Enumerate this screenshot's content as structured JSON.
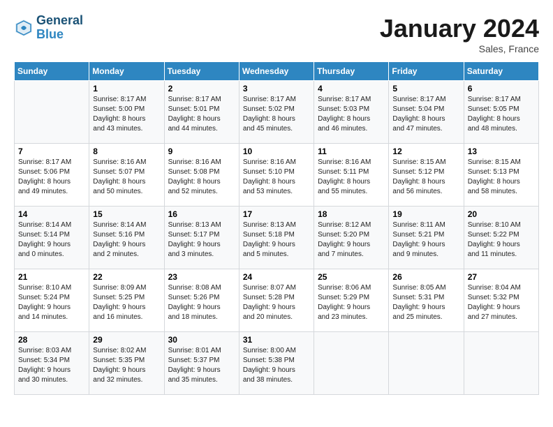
{
  "header": {
    "logo_line1": "General",
    "logo_line2": "Blue",
    "month_title": "January 2024",
    "location": "Sales, France"
  },
  "days_of_week": [
    "Sunday",
    "Monday",
    "Tuesday",
    "Wednesday",
    "Thursday",
    "Friday",
    "Saturday"
  ],
  "weeks": [
    [
      {
        "num": "",
        "info": ""
      },
      {
        "num": "1",
        "info": "Sunrise: 8:17 AM\nSunset: 5:00 PM\nDaylight: 8 hours\nand 43 minutes."
      },
      {
        "num": "2",
        "info": "Sunrise: 8:17 AM\nSunset: 5:01 PM\nDaylight: 8 hours\nand 44 minutes."
      },
      {
        "num": "3",
        "info": "Sunrise: 8:17 AM\nSunset: 5:02 PM\nDaylight: 8 hours\nand 45 minutes."
      },
      {
        "num": "4",
        "info": "Sunrise: 8:17 AM\nSunset: 5:03 PM\nDaylight: 8 hours\nand 46 minutes."
      },
      {
        "num": "5",
        "info": "Sunrise: 8:17 AM\nSunset: 5:04 PM\nDaylight: 8 hours\nand 47 minutes."
      },
      {
        "num": "6",
        "info": "Sunrise: 8:17 AM\nSunset: 5:05 PM\nDaylight: 8 hours\nand 48 minutes."
      }
    ],
    [
      {
        "num": "7",
        "info": "Sunrise: 8:17 AM\nSunset: 5:06 PM\nDaylight: 8 hours\nand 49 minutes."
      },
      {
        "num": "8",
        "info": "Sunrise: 8:16 AM\nSunset: 5:07 PM\nDaylight: 8 hours\nand 50 minutes."
      },
      {
        "num": "9",
        "info": "Sunrise: 8:16 AM\nSunset: 5:08 PM\nDaylight: 8 hours\nand 52 minutes."
      },
      {
        "num": "10",
        "info": "Sunrise: 8:16 AM\nSunset: 5:10 PM\nDaylight: 8 hours\nand 53 minutes."
      },
      {
        "num": "11",
        "info": "Sunrise: 8:16 AM\nSunset: 5:11 PM\nDaylight: 8 hours\nand 55 minutes."
      },
      {
        "num": "12",
        "info": "Sunrise: 8:15 AM\nSunset: 5:12 PM\nDaylight: 8 hours\nand 56 minutes."
      },
      {
        "num": "13",
        "info": "Sunrise: 8:15 AM\nSunset: 5:13 PM\nDaylight: 8 hours\nand 58 minutes."
      }
    ],
    [
      {
        "num": "14",
        "info": "Sunrise: 8:14 AM\nSunset: 5:14 PM\nDaylight: 9 hours\nand 0 minutes."
      },
      {
        "num": "15",
        "info": "Sunrise: 8:14 AM\nSunset: 5:16 PM\nDaylight: 9 hours\nand 2 minutes."
      },
      {
        "num": "16",
        "info": "Sunrise: 8:13 AM\nSunset: 5:17 PM\nDaylight: 9 hours\nand 3 minutes."
      },
      {
        "num": "17",
        "info": "Sunrise: 8:13 AM\nSunset: 5:18 PM\nDaylight: 9 hours\nand 5 minutes."
      },
      {
        "num": "18",
        "info": "Sunrise: 8:12 AM\nSunset: 5:20 PM\nDaylight: 9 hours\nand 7 minutes."
      },
      {
        "num": "19",
        "info": "Sunrise: 8:11 AM\nSunset: 5:21 PM\nDaylight: 9 hours\nand 9 minutes."
      },
      {
        "num": "20",
        "info": "Sunrise: 8:10 AM\nSunset: 5:22 PM\nDaylight: 9 hours\nand 11 minutes."
      }
    ],
    [
      {
        "num": "21",
        "info": "Sunrise: 8:10 AM\nSunset: 5:24 PM\nDaylight: 9 hours\nand 14 minutes."
      },
      {
        "num": "22",
        "info": "Sunrise: 8:09 AM\nSunset: 5:25 PM\nDaylight: 9 hours\nand 16 minutes."
      },
      {
        "num": "23",
        "info": "Sunrise: 8:08 AM\nSunset: 5:26 PM\nDaylight: 9 hours\nand 18 minutes."
      },
      {
        "num": "24",
        "info": "Sunrise: 8:07 AM\nSunset: 5:28 PM\nDaylight: 9 hours\nand 20 minutes."
      },
      {
        "num": "25",
        "info": "Sunrise: 8:06 AM\nSunset: 5:29 PM\nDaylight: 9 hours\nand 23 minutes."
      },
      {
        "num": "26",
        "info": "Sunrise: 8:05 AM\nSunset: 5:31 PM\nDaylight: 9 hours\nand 25 minutes."
      },
      {
        "num": "27",
        "info": "Sunrise: 8:04 AM\nSunset: 5:32 PM\nDaylight: 9 hours\nand 27 minutes."
      }
    ],
    [
      {
        "num": "28",
        "info": "Sunrise: 8:03 AM\nSunset: 5:34 PM\nDaylight: 9 hours\nand 30 minutes."
      },
      {
        "num": "29",
        "info": "Sunrise: 8:02 AM\nSunset: 5:35 PM\nDaylight: 9 hours\nand 32 minutes."
      },
      {
        "num": "30",
        "info": "Sunrise: 8:01 AM\nSunset: 5:37 PM\nDaylight: 9 hours\nand 35 minutes."
      },
      {
        "num": "31",
        "info": "Sunrise: 8:00 AM\nSunset: 5:38 PM\nDaylight: 9 hours\nand 38 minutes."
      },
      {
        "num": "",
        "info": ""
      },
      {
        "num": "",
        "info": ""
      },
      {
        "num": "",
        "info": ""
      }
    ]
  ]
}
